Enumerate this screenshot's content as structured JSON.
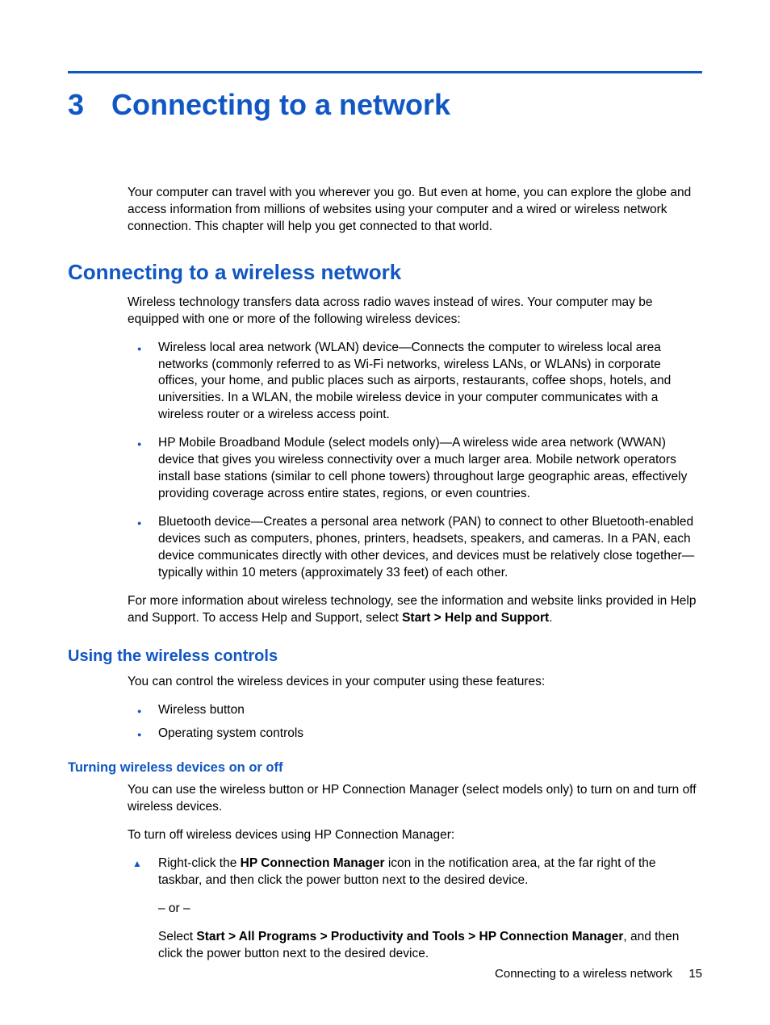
{
  "chapter": {
    "number": "3",
    "title": "Connecting to a network"
  },
  "intro": "Your computer can travel with you wherever you go. But even at home, you can explore the globe and access information from millions of websites using your computer and a wired or wireless network connection. This chapter will help you get connected to that world.",
  "section1": {
    "heading": "Connecting to a wireless network",
    "lead": "Wireless technology transfers data across radio waves instead of wires. Your computer may be equipped with one or more of the following wireless devices:",
    "bullets": [
      "Wireless local area network (WLAN) device—Connects the computer to wireless local area networks (commonly referred to as Wi-Fi networks, wireless LANs, or WLANs) in corporate offices, your home, and public places such as airports, restaurants, coffee shops, hotels, and universities. In a WLAN, the mobile wireless device in your computer communicates with a wireless router or a wireless access point.",
      "HP Mobile Broadband Module (select models only)—A wireless wide area network (WWAN) device that gives you wireless connectivity over a much larger area. Mobile network operators install base stations (similar to cell phone towers) throughout large geographic areas, effectively providing coverage across entire states, regions, or even countries.",
      "Bluetooth device—Creates a personal area network (PAN) to connect to other Bluetooth-enabled devices such as computers, phones, printers, headsets, speakers, and cameras. In a PAN, each device communicates directly with other devices, and devices must be relatively close together—typically within 10 meters (approximately 33 feet) of each other."
    ],
    "closing_pre": "For more information about wireless technology, see the information and website links provided in Help and Support. To access Help and Support, select ",
    "closing_bold": "Start > Help and Support",
    "closing_post": "."
  },
  "section2": {
    "heading": "Using the wireless controls",
    "lead": "You can control the wireless devices in your computer using these features:",
    "bullets": [
      "Wireless button",
      "Operating system controls"
    ]
  },
  "section3": {
    "heading": "Turning wireless devices on or off",
    "p1": "You can use the wireless button or HP Connection Manager (select models only) to turn on and turn off wireless devices.",
    "p2": "To turn off wireless devices using HP Connection Manager:",
    "step": {
      "pre1": "Right-click the ",
      "bold1": "HP Connection Manager",
      "post1": " icon in the notification area, at the far right of the taskbar, and then click the power button next to the desired device.",
      "or": "– or –",
      "pre2": "Select ",
      "bold2": "Start > All Programs > Productivity and Tools > HP Connection Manager",
      "post2": ", and then click the power button next to the desired device."
    }
  },
  "footer": {
    "label": "Connecting to a wireless network",
    "page": "15"
  }
}
